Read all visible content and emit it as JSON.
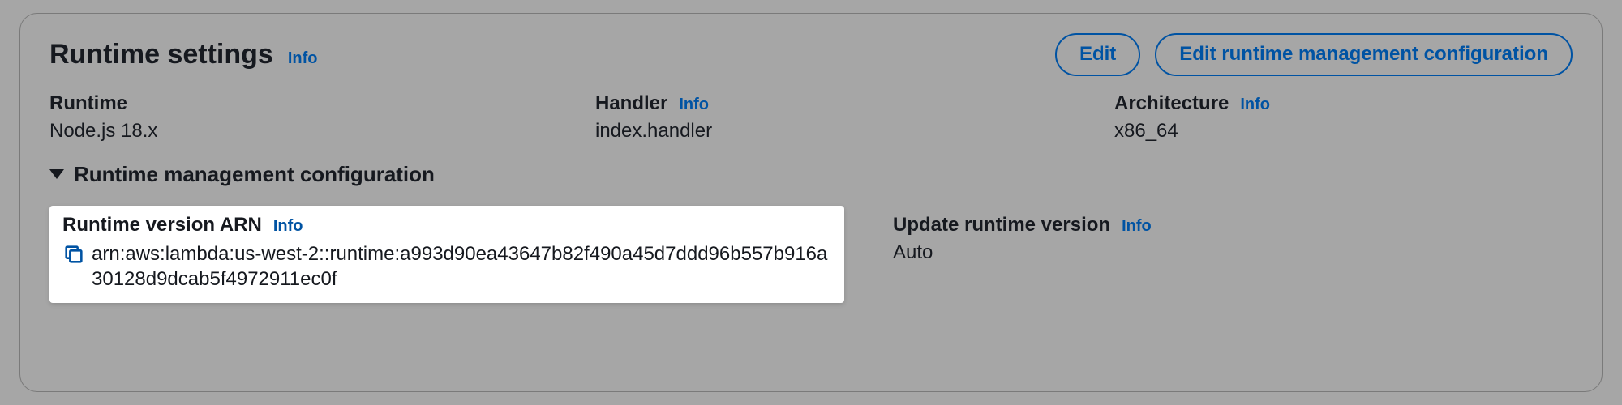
{
  "panel": {
    "title": "Runtime settings",
    "info": "Info"
  },
  "buttons": {
    "edit": "Edit",
    "edit_runtime_mgmt": "Edit runtime management configuration"
  },
  "fields": {
    "runtime": {
      "label": "Runtime",
      "value": "Node.js 18.x"
    },
    "handler": {
      "label": "Handler",
      "value": "index.handler",
      "info": "Info"
    },
    "architecture": {
      "label": "Architecture",
      "value": "x86_64",
      "info": "Info"
    }
  },
  "section": {
    "title": "Runtime management configuration"
  },
  "arn": {
    "label": "Runtime version ARN",
    "info": "Info",
    "value": "arn:aws:lambda:us-west-2::runtime:a993d90ea43647b82f490a45d7ddd96b557b916a30128d9dcab5f4972911ec0f"
  },
  "update": {
    "label": "Update runtime version",
    "info": "Info",
    "value": "Auto"
  }
}
